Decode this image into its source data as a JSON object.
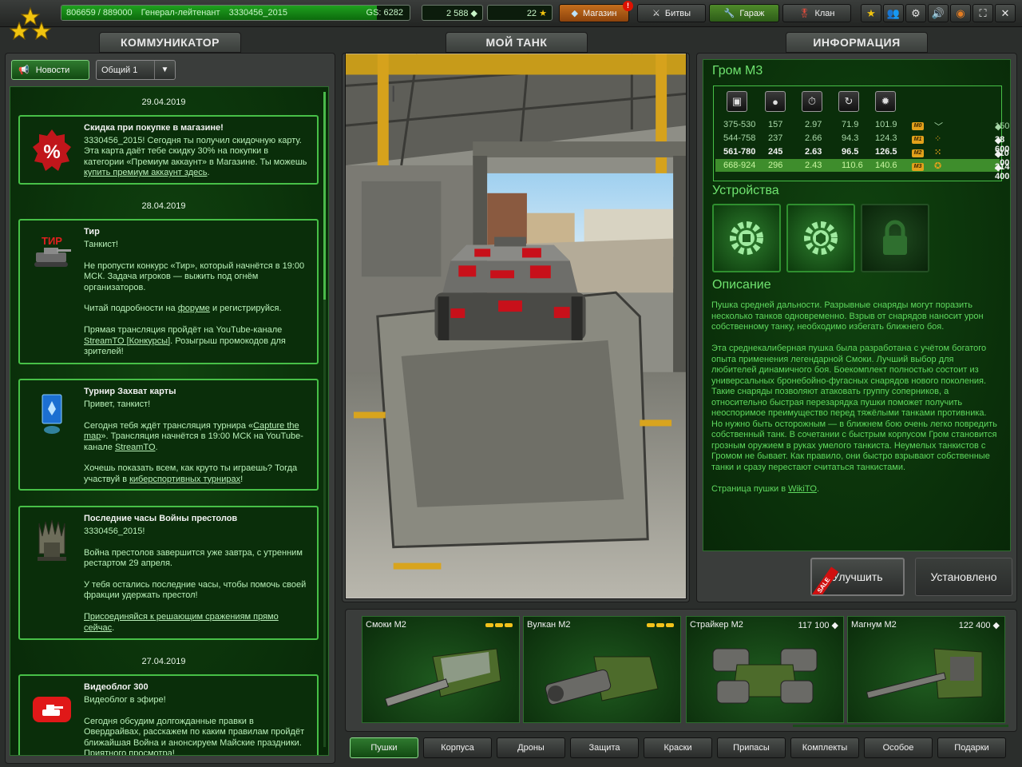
{
  "topbar": {
    "xp_text": "806659 / 889000",
    "rank_name": "Генерал-лейтенант",
    "username": "3330456_2015",
    "gs_text": "GS: 6282",
    "xp_progress": 0.907,
    "crystals": "2 588",
    "stars": "22",
    "shop_label": "Магазин",
    "shop_alert": "!",
    "battles_label": "Битвы",
    "garage_label": "Гараж",
    "clan_label": "Клан"
  },
  "headers": {
    "communicator": "КОММУНИКАТОР",
    "my_tank": "МОЙ ТАНК",
    "info": "ИНФОРМАЦИЯ"
  },
  "news": {
    "tab_label": "Новости",
    "channel": "Общий 1",
    "dates": [
      "29.04.2019",
      "28.04.2019",
      "27.04.2019"
    ],
    "items": [
      {
        "title": "Скидка при покупке в магазине!",
        "body": "3330456_2015! Сегодня ты получил скидочную карту. Эта карта даёт тебе скидку 30% на покупки в категории «Премиум аккаунт» в Магазине. Ты можешь ",
        "link": "купить премиум аккаунт здесь",
        "tail": "."
      },
      {
        "title": "Тир",
        "icon_text": "ТИР",
        "p1": "Танкист!",
        "p2": "Не пропусти конкурс «Тир», который начнётся в 19:00 МСК. Задача игроков — выжить под огнём организаторов.",
        "p3a": "Читай подробности на ",
        "p3link": "форуме",
        "p3b": " и регистрируйся.",
        "p4a": "Прямая трансляция пройдёт на YouTube-канале ",
        "p4link": "StreamTO [Конкурсы]",
        "p4b": ". Розыгрыш промокодов для зрителей!"
      },
      {
        "title": "Турнир Захват карты",
        "p1": "Привет, танкист!",
        "p2a": " Сегодня тебя ждёт трансляция турнира «",
        "p2link": "Capture the map",
        "p2b": "». Трансляция начнётся в 19:00 МСК на YouTube-канале ",
        "p2link2": "StreamTO",
        "p2c": ".",
        "p3a": "Хочешь показать всем, как круто ты играешь? Тогда участвуй в ",
        "p3link": "киберспортивных турнирах",
        "p3b": "!"
      },
      {
        "title": "Последние часы Войны престолов",
        "p1": "3330456_2015!",
        "p2": "Война престолов завершится уже завтра, с утренним рестартом 29 апреля.",
        "p3": "У тебя остались последние часы, чтобы помочь своей фракции удержать престол!",
        "p4link": "Присоединяйся к решающим сражениям прямо сейчас",
        "p4b": "."
      },
      {
        "title": "Видеоблог 300",
        "p1": "Видеоблог в эфире!",
        "p2": "Сегодня обсудим долгожданные правки в Овердрайвах, расскажем по каким правилам пройдёт ближайшая Война и анонсируем Майские праздники. Приятного просмотра!"
      }
    ]
  },
  "info": {
    "item_title": "Гром M3",
    "stats": [
      {
        "c1": "375-530",
        "c2": "157",
        "c3": "2.97",
        "c4": "71.9",
        "c5": "101.9",
        "mod": "M0",
        "price": "150"
      },
      {
        "c1": "544-758",
        "c2": "237",
        "c3": "2.66",
        "c4": "94.3",
        "c5": "124.3",
        "mod": "M1",
        "price": "38 600"
      },
      {
        "c1": "561-780",
        "c2": "245",
        "c3": "2.63",
        "c4": "96.5",
        "c5": "126.5",
        "mod": "M2",
        "price": "110 500"
      },
      {
        "c1": "668-924",
        "c2": "296",
        "c3": "2.43",
        "c4": "110.6",
        "c5": "140.6",
        "mod": "M3",
        "price": "214 400"
      }
    ],
    "devices_title": "Устройства",
    "description_title": "Описание",
    "description": "Пушка средней дальности. Разрывные снаряды могут поразить несколько танков одновременно. Взрыв от снарядов наносит урон собственному танку, необходимо избегать ближнего боя.\n\nЭта среднекалиберная пушка была разработана с учётом богатого опыта применения легендарной Смоки. Лучший выбор для любителей динамичного боя. Боекомплект полностью состоит из универсальных бронебойно-фугасных снарядов нового поколения. Такие снаряды позволяют атаковать группу соперников, а относительно быстрая перезарядка пушки поможет получить неоспоримое преимущество перед тяжёлыми танками противника. Но нужно быть осторожным — в ближнем бою очень легко повредить собственный танк. В сочетании с быстрым корпусом Гром становится грозным оружием в руках умелого танкиста. Неумелых танкистов с Громом не бывает. Как правило, они быстро взрывают собственные танки и сразу перестают считаться танкистами.",
    "wiki_prefix": "Страница пушки в ",
    "wiki_link": "WikiTO",
    "wiki_suffix": ".",
    "upgrade_label": "Улучшить",
    "sale_label": "SALE",
    "installed_label": "Установлено"
  },
  "items": [
    {
      "name": "Смоки M2",
      "price": ""
    },
    {
      "name": "Вулкан M2",
      "price": ""
    },
    {
      "name": "Страйкер M2",
      "price": "117 100"
    },
    {
      "name": "Магнум M2",
      "price": "122 400"
    }
  ],
  "categories": [
    "Пушки",
    "Корпуса",
    "Дроны",
    "Защита",
    "Краски",
    "Припасы",
    "Комплекты",
    "Особое",
    "Подарки"
  ],
  "colors": {
    "accent_green": "#47c047",
    "text_green": "#5fd95f",
    "alert_red": "#dd1100"
  }
}
